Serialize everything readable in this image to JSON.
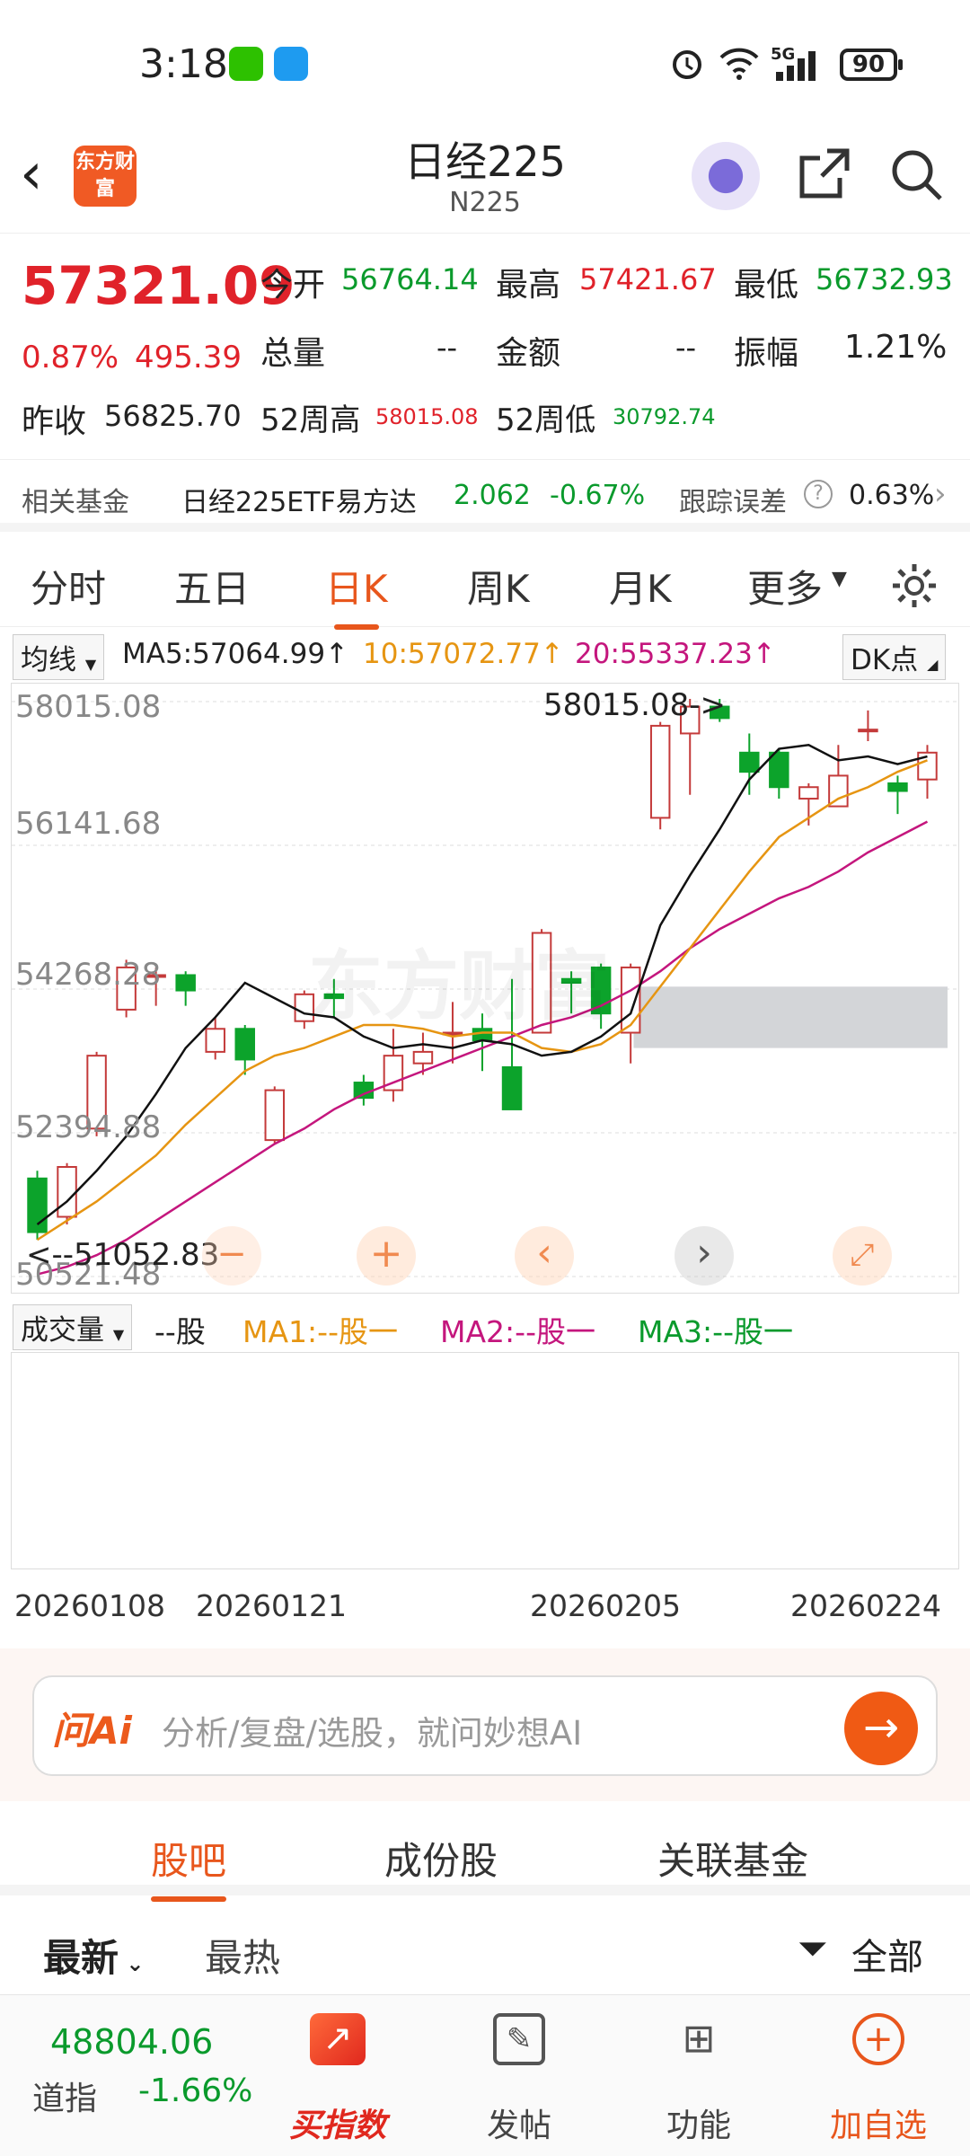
{
  "status": {
    "time": "3:18",
    "battery": "90",
    "net": "5G"
  },
  "header": {
    "title": "日经225",
    "subtitle": "N225",
    "logo": "东方财富"
  },
  "quote": {
    "price": "57321.09",
    "change_pct": "0.87%",
    "change": "495.39",
    "open_label": "今开",
    "open": "56764.14",
    "high_label": "最高",
    "high": "57421.67",
    "low_label": "最低",
    "low": "56732.93",
    "volume_label": "总量",
    "volume": "--",
    "amount_label": "金额",
    "amount": "--",
    "amplitude_label": "振幅",
    "amplitude": "1.21%",
    "prev_label": "昨收",
    "prev": "56825.70",
    "w52h_label": "52周高",
    "w52h": "58015.08",
    "w52l_label": "52周低",
    "w52l": "30792.74"
  },
  "fund": {
    "label": "相关基金",
    "name": "日经225ETF易方达",
    "price": "2.062",
    "pct": "-0.67%",
    "err_label": "跟踪误差",
    "err": "0.63%"
  },
  "tabs": [
    "分时",
    "五日",
    "日K",
    "周K",
    "月K",
    "更多"
  ],
  "ma": {
    "select": "均线",
    "ma5": "MA5:57064.99↑",
    "ma10": "10:57072.77↑",
    "ma20": "20:55337.23↑",
    "dk": "DK点"
  },
  "chart_labels": {
    "y1": "58015.08",
    "y2": "56141.68",
    "y3": "54268.28",
    "y4": "52394.88",
    "y5": "50521.48",
    "max_annot": "58015.08->",
    "min_annot": "<--51052.83",
    "watermark": "东方财富"
  },
  "volume": {
    "select": "成交量",
    "v": "--股",
    "ma1": "MA1:--股一",
    "ma2": "MA2:--股一",
    "ma3": "MA3:--股一"
  },
  "dates": [
    "20260108",
    "20260121",
    "20260205",
    "20260224"
  ],
  "ai": {
    "logo": "问Ai",
    "placeholder": "分析/复盘/选股，就问妙想AI"
  },
  "sub_tabs": [
    "股吧",
    "成份股",
    "关联基金"
  ],
  "sort": {
    "latest": "最新",
    "hot": "最热",
    "filter": "全部"
  },
  "bottom": {
    "dow_price": "48804.06",
    "dow_label": "道指",
    "dow_pct": "-1.66%",
    "items": [
      "买指数",
      "发帖",
      "功能",
      "加自选"
    ]
  },
  "chart_data": {
    "type": "candlestick",
    "ylim": [
      50521.48,
      58015.08
    ],
    "y_ticks": [
      58015.08,
      56141.68,
      54268.28,
      52394.88,
      50521.48
    ],
    "x_ticks": [
      "20260108",
      "20260121",
      "20260205",
      "20260224"
    ],
    "candles": [
      {
        "o": 51800,
        "c": 51100,
        "h": 51900,
        "l": 51000
      },
      {
        "o": 51300,
        "c": 51950,
        "h": 52000,
        "l": 51200
      },
      {
        "o": 52450,
        "c": 53400,
        "h": 53450,
        "l": 52350
      },
      {
        "o": 54000,
        "c": 54550,
        "h": 54650,
        "l": 53900
      },
      {
        "o": 54450,
        "c": 54450,
        "h": 54550,
        "l": 54050
      },
      {
        "o": 54450,
        "c": 54250,
        "h": 54500,
        "l": 54050
      },
      {
        "o": 53450,
        "c": 53750,
        "h": 53900,
        "l": 53350
      },
      {
        "o": 53750,
        "c": 53350,
        "h": 53800,
        "l": 53150
      },
      {
        "o": 52300,
        "c": 52950,
        "h": 53000,
        "l": 52250
      },
      {
        "o": 53850,
        "c": 54200,
        "h": 54250,
        "l": 53750
      },
      {
        "o": 54200,
        "c": 54150,
        "h": 54400,
        "l": 53900
      },
      {
        "o": 53050,
        "c": 52850,
        "h": 53150,
        "l": 52750
      },
      {
        "o": 52950,
        "c": 53400,
        "h": 53750,
        "l": 52800
      },
      {
        "o": 53300,
        "c": 53450,
        "h": 53700,
        "l": 53150
      },
      {
        "o": 53700,
        "c": 53700,
        "h": 54100,
        "l": 53300
      },
      {
        "o": 53750,
        "c": 53600,
        "h": 53950,
        "l": 53200
      },
      {
        "o": 53250,
        "c": 52700,
        "h": 54400,
        "l": 52700
      },
      {
        "o": 53700,
        "c": 55000,
        "h": 55050,
        "l": 53700
      },
      {
        "o": 54400,
        "c": 54350,
        "h": 54500,
        "l": 53950
      },
      {
        "o": 54550,
        "c": 53950,
        "h": 54600,
        "l": 53750
      },
      {
        "o": 53700,
        "c": 54550,
        "h": 54600,
        "l": 53300
      },
      {
        "o": 56500,
        "c": 57700,
        "h": 57750,
        "l": 56350
      },
      {
        "o": 57600,
        "c": 57950,
        "h": 58050,
        "l": 56800
      },
      {
        "o": 57950,
        "c": 57800,
        "h": 58050,
        "l": 57750
      },
      {
        "o": 57350,
        "c": 57100,
        "h": 57600,
        "l": 56800
      },
      {
        "o": 57350,
        "c": 56900,
        "h": 57400,
        "l": 56750
      },
      {
        "o": 56750,
        "c": 56900,
        "h": 56950,
        "l": 56400
      },
      {
        "o": 56650,
        "c": 57050,
        "h": 57450,
        "l": 56650
      },
      {
        "o": 57650,
        "c": 57650,
        "h": 57900,
        "l": 57500
      },
      {
        "o": 56950,
        "c": 56850,
        "h": 57050,
        "l": 56550
      },
      {
        "o": 57000,
        "c": 57350,
        "h": 57450,
        "l": 56750
      }
    ],
    "ma5": [
      51200,
      51500,
      51900,
      52350,
      52900,
      53500,
      53900,
      54350,
      54150,
      53950,
      53900,
      53650,
      53500,
      53550,
      53500,
      53600,
      53550,
      53400,
      53450,
      53650,
      53950,
      55100,
      55750,
      56350,
      57000,
      57400,
      57450,
      57250,
      57300,
      57200,
      57300
    ],
    "ma10": [
      51000,
      51250,
      51500,
      51800,
      52100,
      52500,
      52850,
      53200,
      53400,
      53500,
      53650,
      53800,
      53800,
      53750,
      53650,
      53700,
      53700,
      53500,
      53450,
      53550,
      53800,
      54300,
      54800,
      55300,
      55800,
      56250,
      56500,
      56750,
      56900,
      57100,
      57250
    ],
    "ma20": [
      50550,
      50650,
      50800,
      51000,
      51250,
      51500,
      51750,
      52000,
      52250,
      52450,
      52700,
      52900,
      53050,
      53200,
      53350,
      53500,
      53650,
      53800,
      53900,
      54050,
      54250,
      54500,
      54800,
      55050,
      55250,
      55450,
      55600,
      55800,
      56050,
      56250,
      56450
    ]
  }
}
